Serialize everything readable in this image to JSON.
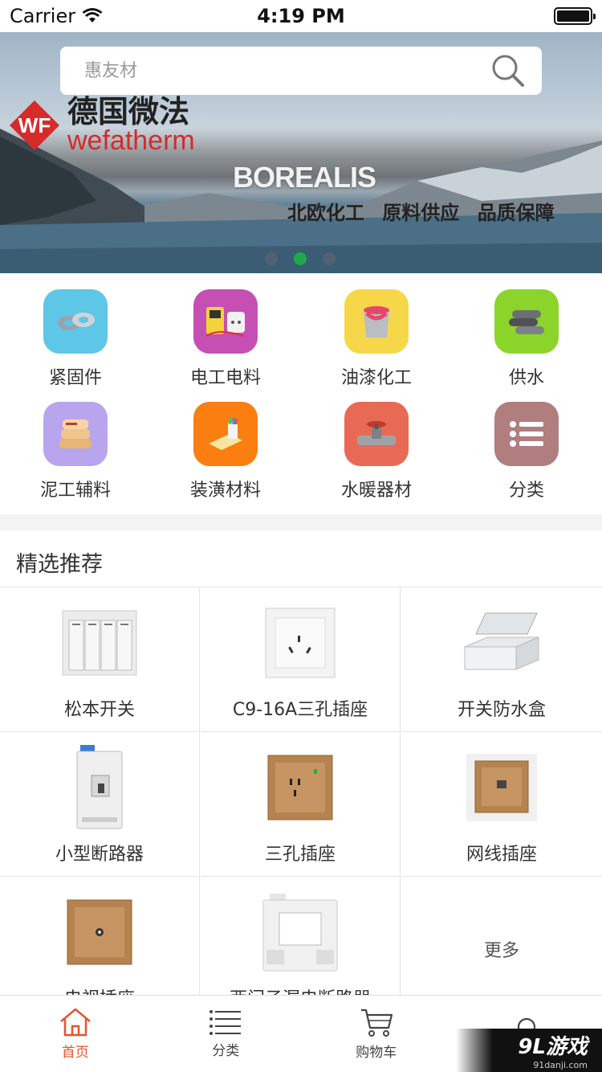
{
  "status_bar": {
    "carrier": "Carrier",
    "time": "4:19 PM"
  },
  "search": {
    "placeholder": "惠友材"
  },
  "banner": {
    "brand_cn": "德国微法",
    "brand_en": "wefatherm",
    "logo_text": "WF",
    "headline": "BOREALIS",
    "slogan": "北欧化工 原料供应 品质保障",
    "pagination": {
      "count": 3,
      "active_index": 1
    }
  },
  "categories": [
    {
      "label": "紧固件",
      "icon": "fastener-icon",
      "color": "#5ec6e6"
    },
    {
      "label": "电工电料",
      "icon": "electrical-icon",
      "color": "#c64fb4"
    },
    {
      "label": "油漆化工",
      "icon": "paint-bucket-icon",
      "color": "#f7d74a"
    },
    {
      "label": "供水",
      "icon": "pipe-icon",
      "color": "#8bd52a"
    },
    {
      "label": "泥工辅料",
      "icon": "cement-bag-icon",
      "color": "#b8a5ee"
    },
    {
      "label": "装潢材料",
      "icon": "decoration-icon",
      "color": "#fa7e10"
    },
    {
      "label": "水暖器材",
      "icon": "valve-icon",
      "color": "#e86a55"
    },
    {
      "label": "分类",
      "icon": "list-icon",
      "color": "#b07e7e"
    }
  ],
  "recommend": {
    "title": "精选推荐",
    "items": [
      {
        "name": "松本开关"
      },
      {
        "name": "C9-16A三孔插座"
      },
      {
        "name": "开关防水盒"
      },
      {
        "name": "小型断路器"
      },
      {
        "name": "三孔插座"
      },
      {
        "name": "网线插座"
      },
      {
        "name": "电视插座"
      },
      {
        "name": "西门子漏电断路器"
      }
    ],
    "more_label": "更多"
  },
  "tabbar": {
    "items": [
      {
        "label": "首页",
        "icon": "home-icon",
        "active": true
      },
      {
        "label": "分类",
        "icon": "list-icon",
        "active": false
      },
      {
        "label": "购物车",
        "icon": "cart-icon",
        "active": false
      },
      {
        "label": "",
        "icon": "user-icon",
        "active": false
      }
    ]
  },
  "watermark": {
    "brand": "9L游戏",
    "site": "91danji.com"
  },
  "colors": {
    "accent": "#e2572c",
    "active_dot": "#1fa84a"
  }
}
